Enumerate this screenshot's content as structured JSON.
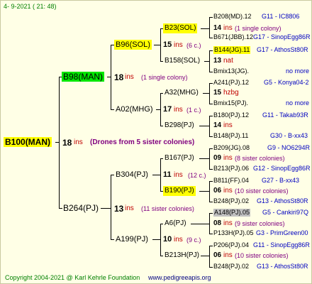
{
  "header": {
    "date": "4-  9-2021 ( 21: 48)"
  },
  "root": {
    "name": "B100(MAN)",
    "ins_count": "18",
    "ins_word": "ins",
    "note": "(Drones from 5 sister colonies)"
  },
  "gen1": [
    {
      "name": "B98(MAN)",
      "ins_count": "18",
      "ins_word": "ins",
      "note": "(1 single colony)"
    },
    {
      "name": "B264(PJ)",
      "ins_count": "13",
      "ins_word": "ins",
      "note": "(11 sister colonies)"
    }
  ],
  "gen2": [
    {
      "name": "B96(SOL)",
      "ins_count": "15",
      "ins_word": "ins",
      "note": "(6 c.)"
    },
    {
      "name": "A02(MHG)",
      "ins_count": "17",
      "ins_word": "ins",
      "note": "(1 c.)"
    },
    {
      "name": "B304(PJ)",
      "ins_count": "11",
      "ins_word": "ins",
      "note": "(12 c.)"
    },
    {
      "name": "A199(PJ)",
      "ins_count": "10",
      "ins_word": "ins",
      "note": "(9 c.)"
    }
  ],
  "gen3": [
    {
      "name": "B23(SOL)",
      "ins_count": "14",
      "ins_word": "ins",
      "note": "(1 single colony)"
    },
    {
      "name": "B158(SOL)",
      "ins_count": "13",
      "ins_word": "nat",
      "note": ""
    },
    {
      "name": "A32(MHG)",
      "ins_count": "15",
      "ins_word": "hzbg",
      "note": ""
    },
    {
      "name": "B298(PJ)",
      "ins_count": "14",
      "ins_word": "ins",
      "note": ""
    },
    {
      "name": "B167(PJ)",
      "ins_count": "09",
      "ins_word": "ins",
      "note": "(8 sister colonies)"
    },
    {
      "name": "B190(PJ)",
      "ins_count": "06",
      "ins_word": "ins",
      "note": "(10 sister colonies)"
    },
    {
      "name": "A6(PJ)",
      "ins_count": "08",
      "ins_word": "ins",
      "note": "(9 sister colonies)"
    },
    {
      "name": "B213H(PJ)",
      "ins_count": "06",
      "ins_word": "ins",
      "note": "(10 sister colonies)"
    }
  ],
  "gen4": [
    {
      "name": "B208(MD).12",
      "tag": "G11 - IC8806"
    },
    {
      "name": "B671(JBB).12",
      "tag": "G17 - SinopEgg86R"
    },
    {
      "name": "B144(JG).11",
      "tag": "G17 - AthosSt80R"
    },
    {
      "name": "Bmix13(JG).",
      "tag": "no more"
    },
    {
      "name": "A241(PJ).12",
      "tag": "G5 - Konya04-2"
    },
    {
      "name": "Bmix15(PJ).",
      "tag": "no more"
    },
    {
      "name": "B180(PJ).12",
      "tag": "G11 - Takab93R"
    },
    {
      "name": "B148(PJ).11",
      "tag": "G30 - B-xx43"
    },
    {
      "name": "B209(JG).08",
      "tag": "G9 - NO6294R"
    },
    {
      "name": "B213(PJ).06",
      "tag": "G12 - SinopEgg86R"
    },
    {
      "name": "B811(FF).04",
      "tag": "G27 - B-xx43"
    },
    {
      "name": "B248(PJ).02",
      "tag": "G13 - AthosSt80R"
    },
    {
      "name": "A148(PJ).05",
      "tag": "G5 - Cankiri97Q"
    },
    {
      "name": "P133H(PJ).05",
      "tag": "G3 - PrimGreen00"
    },
    {
      "name": "P206(PJ).04",
      "tag": "G11 - SinopEgg86R"
    },
    {
      "name": "B248(PJ).02",
      "tag": "G13 - AthosSt80R"
    }
  ],
  "footer": {
    "copyright": "Copyright 2004-2021 @ Karl Kehrle Foundation",
    "site": "www.pedigreeapis.org"
  }
}
